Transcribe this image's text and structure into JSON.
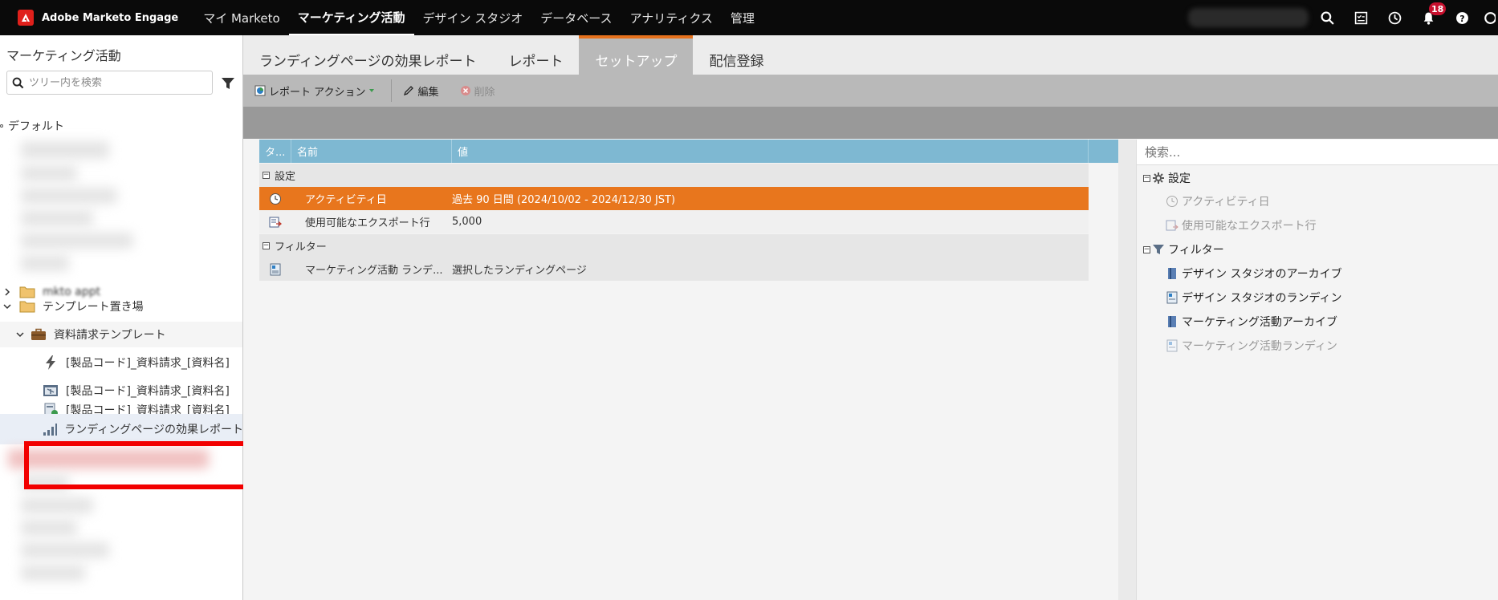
{
  "topnav": {
    "brand": "Adobe Marketo Engage",
    "items": [
      {
        "label": "マイ Marketo",
        "active": false
      },
      {
        "label": "マーケティング活動",
        "active": true
      },
      {
        "label": "デザイン スタジオ",
        "active": false
      },
      {
        "label": "データベース",
        "active": false
      },
      {
        "label": "アナリティクス",
        "active": false
      },
      {
        "label": "管理",
        "active": false
      }
    ],
    "notification_count": "18",
    "icons": [
      "search-icon",
      "checklist-icon",
      "clock-icon",
      "bell-icon",
      "help-icon"
    ]
  },
  "sidebar": {
    "title": "マーケティング活動",
    "search_placeholder": "ツリー内を検索",
    "default_label": "デフォルト",
    "partial_folder": "mkto appt",
    "template_folder": "テンプレート置き場",
    "program": "資料請求テンプレート",
    "assets": [
      {
        "label": "[製品コード]_資料請求_[資料名]",
        "icon": "smart-campaign-bolt-icon"
      },
      {
        "label": "[製品コード]_資料請求_[資料名]",
        "icon": "email-icon"
      },
      {
        "label": "[製品コード]_資料請求_[資料名]",
        "icon": "landing-page-icon"
      },
      {
        "label": "ランディングページの効果レポート",
        "icon": "report-chart-icon"
      }
    ]
  },
  "tabs": [
    {
      "label": "ランディングページの効果レポート",
      "active": false
    },
    {
      "label": "レポート",
      "active": false
    },
    {
      "label": "セットアップ",
      "active": true
    },
    {
      "label": "配信登録",
      "active": false
    }
  ],
  "toolbar": {
    "report_actions": "レポート アクション",
    "edit": "編集",
    "delete": "削除"
  },
  "grid": {
    "headers": [
      "タ...",
      "名前",
      "値"
    ],
    "groups": [
      {
        "label": "設定",
        "rows": [
          {
            "name": "アクティビティ日",
            "value": "過去 90 日間 (2024/10/02 - 2024/12/30 JST)",
            "selected": true,
            "icon": "clock-icon"
          },
          {
            "name": "使用可能なエクスポート行",
            "value": "5,000",
            "selected": false,
            "icon": "export-icon"
          }
        ]
      },
      {
        "label": "フィルター",
        "rows": [
          {
            "name": "マーケティング活動 ランデ...",
            "value": "選択したランディングページ",
            "selected": false,
            "icon": "landing-page-icon"
          }
        ]
      }
    ]
  },
  "right_panel": {
    "search_placeholder": "検索...",
    "settings_label": "設定",
    "settings_items": [
      "アクティビティ日",
      "使用可能なエクスポート行"
    ],
    "filters_label": "フィルター",
    "filter_items": [
      {
        "label": "デザイン スタジオのアーカイブ",
        "dim": false
      },
      {
        "label": "デザイン スタジオのランディン",
        "dim": false
      },
      {
        "label": "マーケティング活動アーカイブ",
        "dim": false
      },
      {
        "label": "マーケティング活動ランディン",
        "dim": true
      }
    ]
  },
  "colors": {
    "accent_orange": "#e8761d",
    "grid_header_blue": "#7eb8d2",
    "highlight_red": "#f20000"
  }
}
